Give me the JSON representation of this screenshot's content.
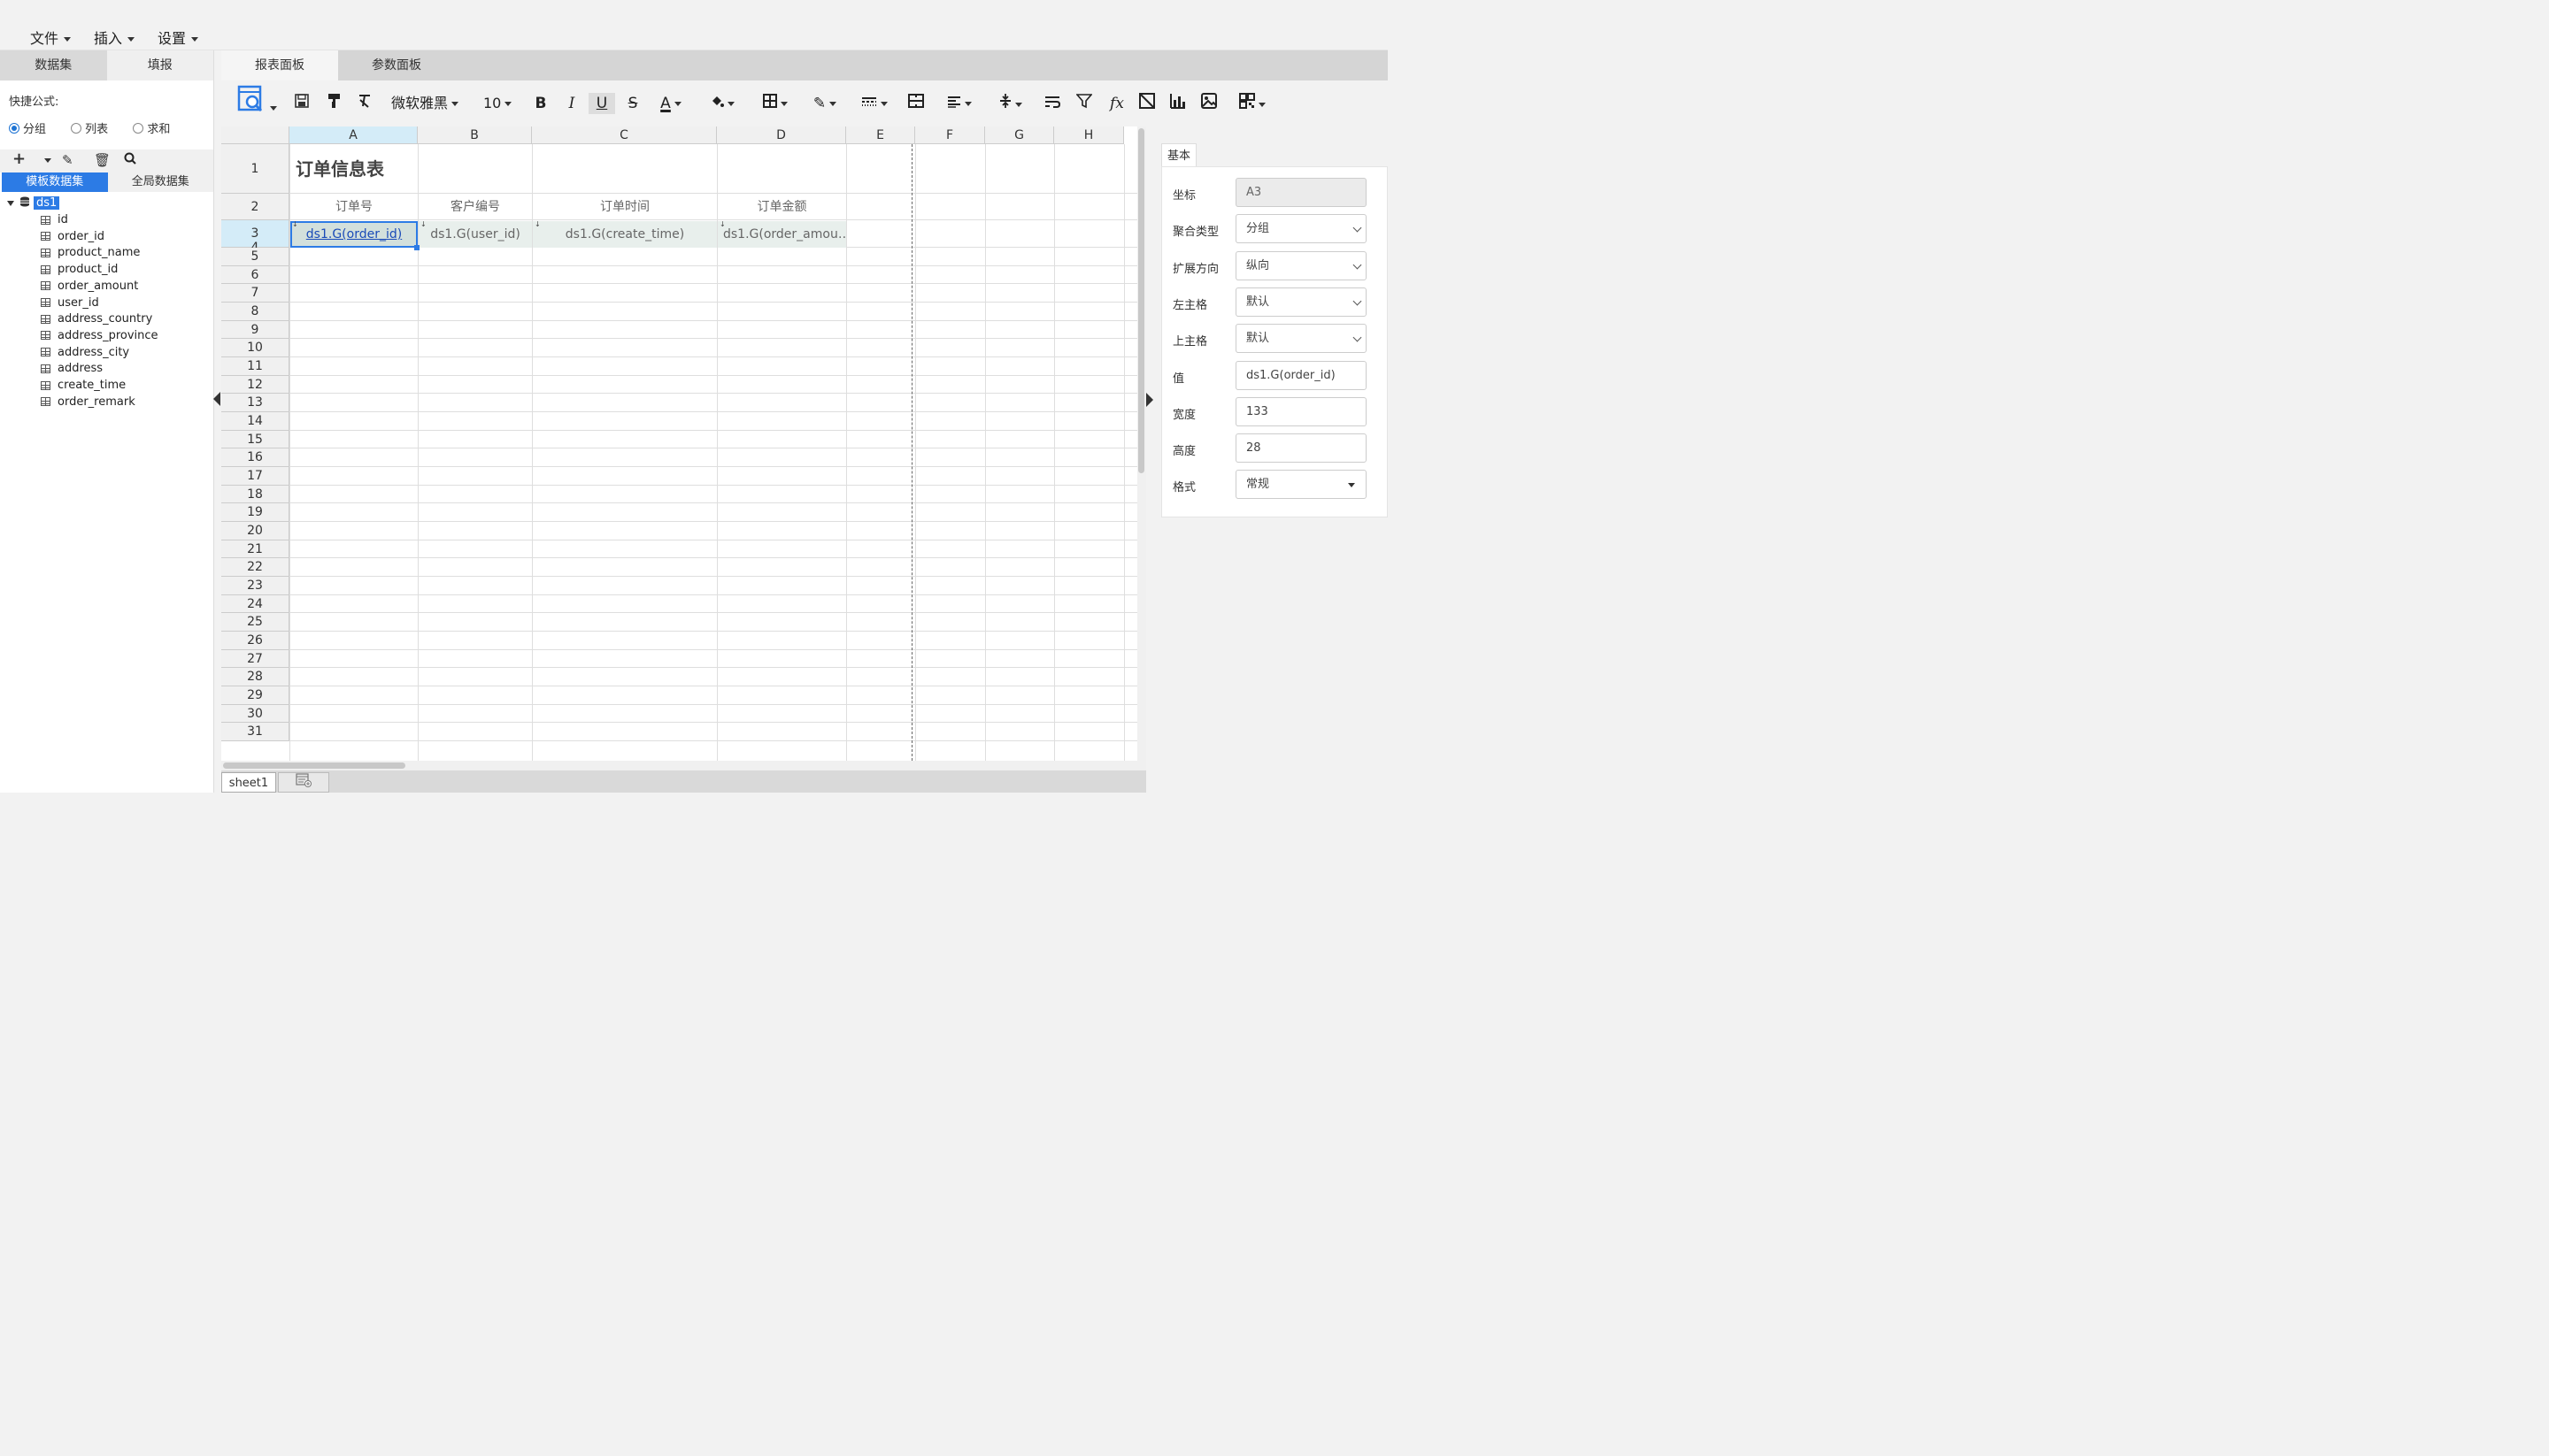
{
  "menubar": {
    "items": [
      "文件",
      "插入",
      "设置"
    ]
  },
  "left_panel": {
    "tabs": [
      "数据集",
      "填报"
    ],
    "quick_formula_label": "快捷公式:",
    "radios": [
      {
        "label": "分组",
        "checked": true
      },
      {
        "label": "列表",
        "checked": false
      },
      {
        "label": "求和",
        "checked": false
      }
    ],
    "ds_tabs": [
      "模板数据集",
      "全局数据集"
    ],
    "dataset": {
      "name": "ds1",
      "fields": [
        "id",
        "order_id",
        "product_name",
        "product_id",
        "order_amount",
        "user_id",
        "address_country",
        "address_province",
        "address_city",
        "address",
        "create_time",
        "order_remark"
      ]
    }
  },
  "main_tabs": [
    "报表面板",
    "参数面板"
  ],
  "toolbar": {
    "font_name": "微软雅黑",
    "font_size": "10"
  },
  "grid": {
    "columns": [
      "A",
      "B",
      "C",
      "D",
      "E",
      "F",
      "G",
      "H"
    ],
    "selected_column": "A",
    "selected_row": 3,
    "row_count": 31,
    "title": "订单信息表",
    "headers": [
      "订单号",
      "客户编号",
      "订单时间",
      "订单金额"
    ],
    "data_cells": [
      "ds1.G(order_id)",
      "ds1.G(user_id)",
      "ds1.G(create_time)",
      "ds1.G(order_amou…"
    ]
  },
  "sheets": [
    "sheet1"
  ],
  "properties": {
    "tab": "基本",
    "rows": [
      {
        "label": "坐标",
        "value": "A3",
        "kind": "readonly"
      },
      {
        "label": "聚合类型",
        "value": "分组",
        "kind": "select"
      },
      {
        "label": "扩展方向",
        "value": "纵向",
        "kind": "select"
      },
      {
        "label": "左主格",
        "value": "默认",
        "kind": "select"
      },
      {
        "label": "上主格",
        "value": "默认",
        "kind": "select"
      },
      {
        "label": "值",
        "value": "ds1.G(order_id)",
        "kind": "input"
      },
      {
        "label": "宽度",
        "value": "133",
        "kind": "input"
      },
      {
        "label": "高度",
        "value": "28",
        "kind": "input"
      },
      {
        "label": "格式",
        "value": "常规",
        "kind": "dropdown"
      }
    ]
  },
  "colors": {
    "accent": "#2c7be5",
    "selection_header": "#d4ecf8"
  }
}
